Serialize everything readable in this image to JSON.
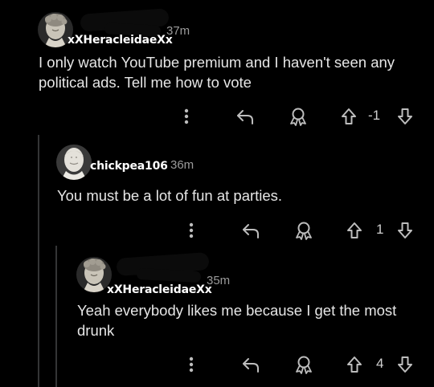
{
  "comments": [
    {
      "username": "xXHeracleidaeXx",
      "time": "37m",
      "text": "I only watch YouTube premium and I haven't seen any political ads. Tell me how to vote",
      "score": "-1",
      "avatar_icon": "bust-statue-icon"
    },
    {
      "username": "chickpea106",
      "time": "36m",
      "text": "You must be a lot of fun at parties.",
      "score": "1",
      "avatar_icon": "bust-statue-icon"
    },
    {
      "username": "xXHeracleidaeXx",
      "time": "35m",
      "text": "Yeah everybody likes me because I get the most drunk",
      "score": "4",
      "avatar_icon": "bust-statue-icon"
    }
  ],
  "actions": {
    "more_icon": "more-vertical-icon",
    "reply_icon": "reply-arrow-icon",
    "award_icon": "award-ribbon-icon",
    "upvote_icon": "upvote-arrow-icon",
    "downvote_icon": "downvote-arrow-icon"
  },
  "colors": {
    "background": "#000000",
    "text": "#e6e6e6",
    "muted": "#9a9a9a",
    "thread_line": "#343536",
    "icon": "#bdbdbd"
  }
}
